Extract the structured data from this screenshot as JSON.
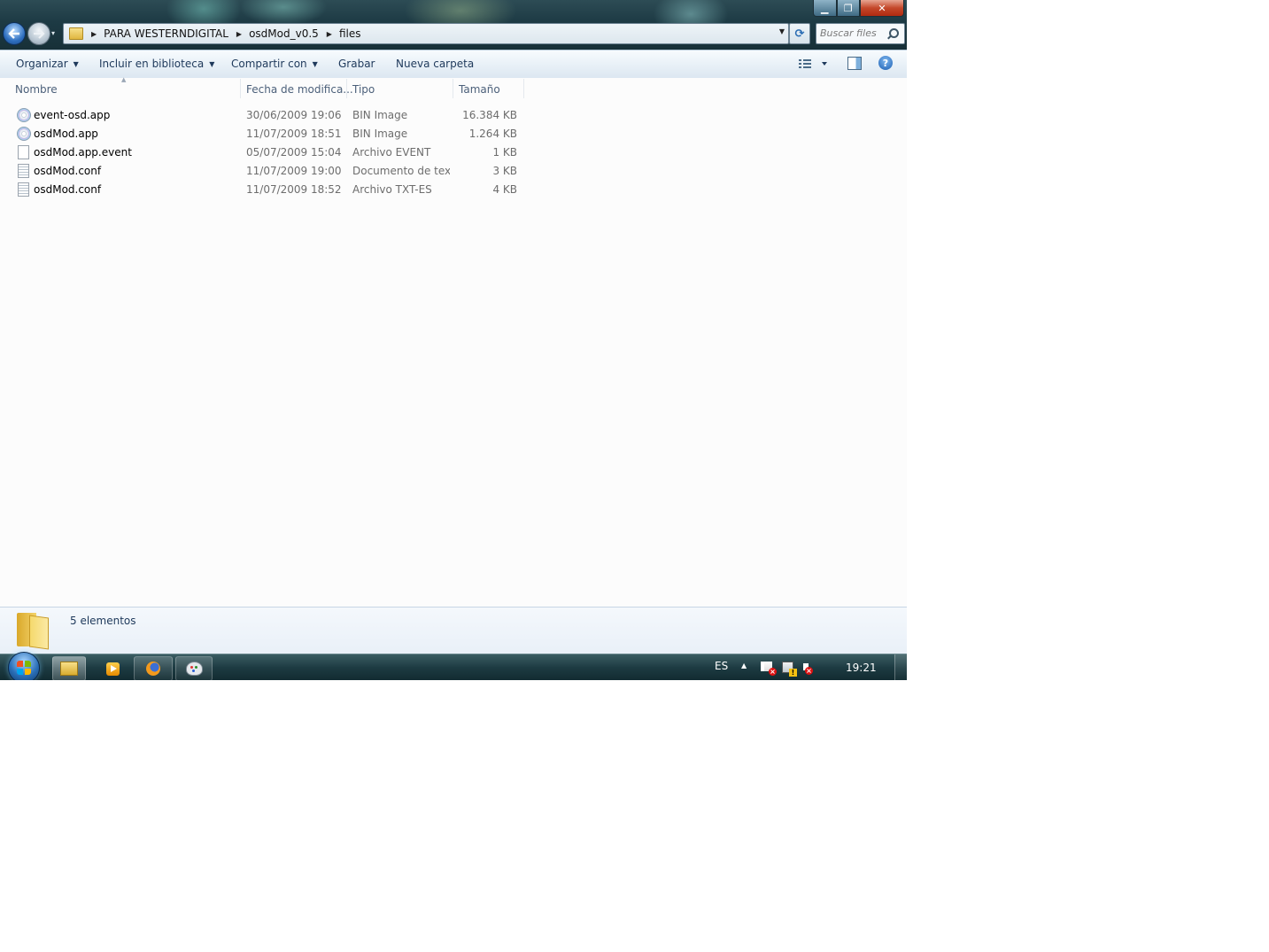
{
  "window": {
    "controls": {
      "minimize": "▁",
      "maximize": "❐",
      "close": "✕"
    }
  },
  "nav": {
    "back_icon": "back-arrow-icon",
    "forward_icon": "forward-arrow-icon",
    "history_caret": "▾"
  },
  "address": {
    "breadcrumb": [
      "PARA WESTERNDIGITAL",
      "osdMod_v0.5",
      "files"
    ],
    "separator": "▶",
    "dropdown": "▼",
    "refresh": "⟳"
  },
  "search": {
    "placeholder": "Buscar files"
  },
  "toolbar": {
    "organize": "Organizar",
    "include_library": "Incluir en biblioteca",
    "share_with": "Compartir con",
    "burn": "Grabar",
    "new_folder": "Nueva carpeta",
    "caret": "▼",
    "help": "?"
  },
  "columns": {
    "name": "Nombre",
    "date": "Fecha de modifica...",
    "type": "Tipo",
    "size": "Tamaño",
    "sort_indicator": "▲"
  },
  "files": [
    {
      "name": "event-osd.app",
      "date": "30/06/2009 19:06",
      "type": "BIN Image",
      "size": "16.384 KB",
      "icon": "disc-image-icon"
    },
    {
      "name": "osdMod.app",
      "date": "11/07/2009 18:51",
      "type": "BIN Image",
      "size": "1.264 KB",
      "icon": "disc-image-icon"
    },
    {
      "name": "osdMod.app.event",
      "date": "05/07/2009 15:04",
      "type": "Archivo EVENT",
      "size": "1 KB",
      "icon": "blank-file-icon"
    },
    {
      "name": "osdMod.conf",
      "date": "11/07/2009 19:00",
      "type": "Documento de tex...",
      "size": "3 KB",
      "icon": "text-file-icon"
    },
    {
      "name": "osdMod.conf",
      "date": "11/07/2009 18:52",
      "type": "Archivo TXT-ES",
      "size": "4 KB",
      "icon": "text-file-icon"
    }
  ],
  "details": {
    "count_text": "5 elementos"
  },
  "taskbar": {
    "language": "ES",
    "tray_up": "▲",
    "clock": "19:21",
    "pinned": [
      "explorer-icon",
      "media-player-icon",
      "firefox-icon",
      "paint-icon"
    ]
  },
  "colors": {
    "command_text": "#1e395b",
    "column_header_text": "#4c607a",
    "secondary_text": "#6d6d6d",
    "taskbar": "#1d3b42"
  }
}
